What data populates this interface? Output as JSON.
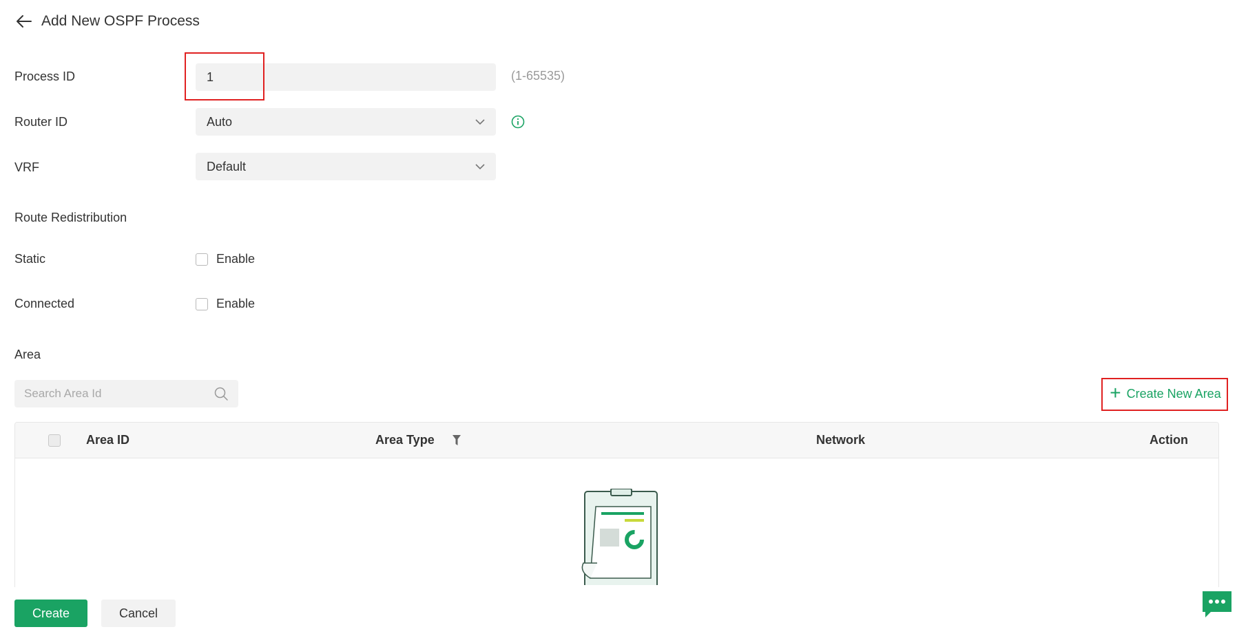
{
  "header": {
    "title": "Add New OSPF Process",
    "back_icon": "arrow-left-icon"
  },
  "form": {
    "process_id": {
      "label": "Process ID",
      "value": "1",
      "hint": "(1-65535)"
    },
    "router_id": {
      "label": "Router ID",
      "value": "Auto",
      "info_icon": "info-icon"
    },
    "vrf": {
      "label": "VRF",
      "value": "Default"
    }
  },
  "route_redistribution": {
    "title": "Route Redistribution",
    "static": {
      "label": "Static",
      "option": "Enable",
      "checked": false
    },
    "connected": {
      "label": "Connected",
      "option": "Enable",
      "checked": false
    }
  },
  "area": {
    "title": "Area",
    "search": {
      "placeholder": "Search Area Id",
      "icon": "search-icon"
    },
    "create_button": "Create New Area",
    "table": {
      "columns": [
        "Area ID",
        "Area Type",
        "Network",
        "Action"
      ],
      "rows": []
    }
  },
  "footer": {
    "create_label": "Create",
    "cancel_label": "Cancel"
  },
  "colors": {
    "accent": "#1aa363",
    "highlight": "#e02020",
    "field_bg": "#f2f2f2"
  }
}
